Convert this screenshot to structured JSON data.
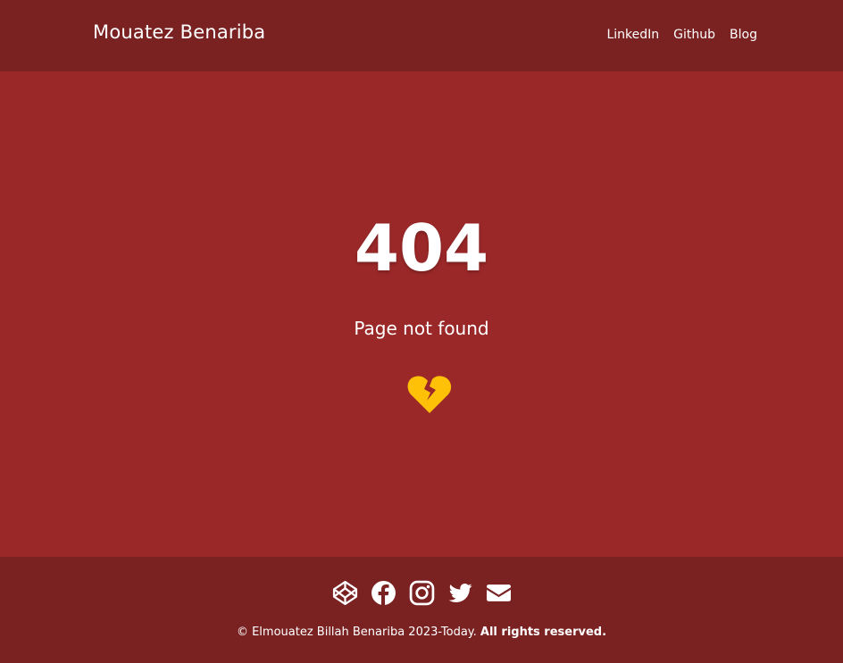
{
  "header": {
    "brand": "Mouatez Benariba",
    "nav": [
      {
        "label": "LinkedIn"
      },
      {
        "label": "Github"
      },
      {
        "label": "Blog"
      }
    ]
  },
  "error": {
    "code": "404",
    "message": "Page not found",
    "icon": "broken-heart-icon",
    "icon_color": "#ffc107"
  },
  "footer": {
    "social": [
      {
        "icon": "codepen-icon"
      },
      {
        "icon": "facebook-icon"
      },
      {
        "icon": "instagram-icon"
      },
      {
        "icon": "twitter-icon"
      },
      {
        "icon": "envelope-icon"
      }
    ],
    "copyright_text": "© Elmouatez Billah Benariba 2023-Today.",
    "rights_text": "All rights reserved."
  },
  "colors": {
    "background": "#9b2828",
    "header_footer": "#7a2222",
    "accent": "#ffc107"
  }
}
